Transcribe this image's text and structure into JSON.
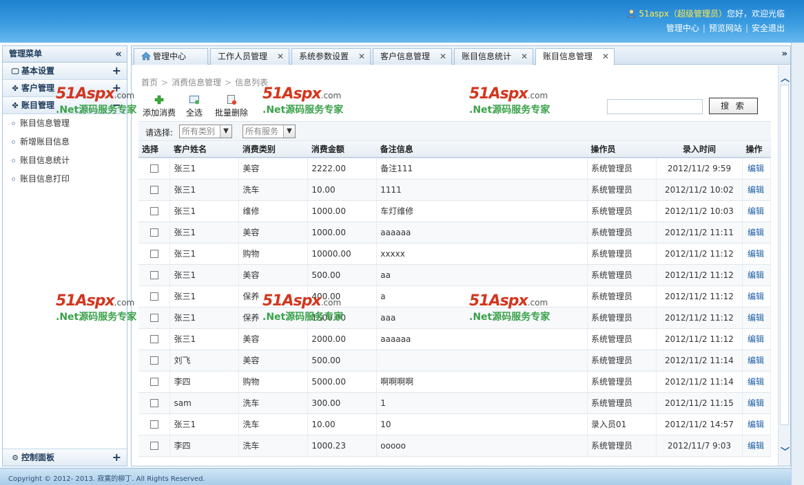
{
  "header": {
    "user_name": "51aspx（超级管理员）",
    "welcome_suffix": "您好，欢迎光临",
    "links": [
      "管理中心",
      "预览网站",
      "安全退出"
    ]
  },
  "sidebar": {
    "title": "管理菜单",
    "groups": [
      {
        "label": "基本设置"
      },
      {
        "label": "客户管理"
      },
      {
        "label": "账目管理"
      }
    ],
    "items": [
      {
        "label": "账目信息管理"
      },
      {
        "label": "新增账目信息"
      },
      {
        "label": "账目信息统计"
      },
      {
        "label": "账目信息打印"
      }
    ],
    "bottom_group": "控制面板"
  },
  "tabs": [
    {
      "label": "管理中心"
    },
    {
      "label": "工作人员管理"
    },
    {
      "label": "系统参数设置"
    },
    {
      "label": "客户信息管理"
    },
    {
      "label": "账目信息统计"
    },
    {
      "label": "账目信息管理"
    }
  ],
  "breadcrumb": [
    "首页",
    "消费信息管理",
    "信息列表"
  ],
  "toolbar": {
    "add_label": "添加消费",
    "select_all_label": "全选",
    "batch_delete_label": "批量删除",
    "search_label": "搜 索",
    "search_value": ""
  },
  "filter": {
    "label": "请选择:",
    "category_selected": "所有类别",
    "service_selected": "所有服务"
  },
  "table": {
    "columns": [
      "选择",
      "客户姓名",
      "消费类别",
      "消费金额",
      "备注信息",
      "操作员",
      "录入时间",
      "操作"
    ],
    "rows": [
      {
        "name": "张三1",
        "category": "美容",
        "amount": "2222.00",
        "note": "备注111",
        "operator": "系统管理员",
        "time": "2012/11/2 9:59",
        "action": "编辑"
      },
      {
        "name": "张三1",
        "category": "洗车",
        "amount": "10.00",
        "note": "1111",
        "operator": "系统管理员",
        "time": "2012/11/2 10:02",
        "action": "编辑"
      },
      {
        "name": "张三1",
        "category": "维修",
        "amount": "1000.00",
        "note": "车灯维修",
        "operator": "系统管理员",
        "time": "2012/11/2 10:03",
        "action": "编辑"
      },
      {
        "name": "张三1",
        "category": "美容",
        "amount": "1000.00",
        "note": "aaaaaa",
        "operator": "系统管理员",
        "time": "2012/11/2 11:11",
        "action": "编辑"
      },
      {
        "name": "张三1",
        "category": "购物",
        "amount": "10000.00",
        "note": "xxxxx",
        "operator": "系统管理员",
        "time": "2012/11/2 11:12",
        "action": "编辑"
      },
      {
        "name": "张三1",
        "category": "美容",
        "amount": "500.00",
        "note": "aa",
        "operator": "系统管理员",
        "time": "2012/11/2 11:12",
        "action": "编辑"
      },
      {
        "name": "张三1",
        "category": "保养",
        "amount": "400.00",
        "note": "a",
        "operator": "系统管理员",
        "time": "2012/11/2 11:12",
        "action": "编辑"
      },
      {
        "name": "张三1",
        "category": "保养",
        "amount": "1500.00",
        "note": "aaa",
        "operator": "系统管理员",
        "time": "2012/11/2 11:12",
        "action": "编辑"
      },
      {
        "name": "张三1",
        "category": "美容",
        "amount": "2000.00",
        "note": "aaaaaa",
        "operator": "系统管理员",
        "time": "2012/11/2 11:12",
        "action": "编辑"
      },
      {
        "name": "刘飞",
        "category": "美容",
        "amount": "500.00",
        "note": "",
        "operator": "系统管理员",
        "time": "2012/11/2 11:14",
        "action": "编辑"
      },
      {
        "name": "李四",
        "category": "购物",
        "amount": "5000.00",
        "note": "啊啊啊啊",
        "operator": "系统管理员",
        "time": "2012/11/2 11:14",
        "action": "编辑"
      },
      {
        "name": "sam",
        "category": "洗车",
        "amount": "300.00",
        "note": "1",
        "operator": "系统管理员",
        "time": "2012/11/2 11:15",
        "action": "编辑"
      },
      {
        "name": "张三1",
        "category": "洗车",
        "amount": "10.00",
        "note": "10",
        "operator": "录入员01",
        "time": "2012/11/2 14:57",
        "action": "编辑"
      },
      {
        "name": "李四",
        "category": "洗车",
        "amount": "1000.23",
        "note": "ooooo",
        "operator": "系统管理员",
        "time": "2012/11/7 9:03",
        "action": "编辑"
      }
    ]
  },
  "watermark": {
    "logo": "51Aspx",
    "logo_suffix": ".com",
    "slogan": ".Net源码服务专家"
  },
  "footer": {
    "copyright": "Copyright © 2012- 2013. 寂寞的柳丁. All Rights Reserved."
  },
  "colors": {
    "header_top": "#1f82d0",
    "link": "#1c5fa8",
    "watermark_red": "#d3361e",
    "watermark_green": "#3aa14a"
  }
}
